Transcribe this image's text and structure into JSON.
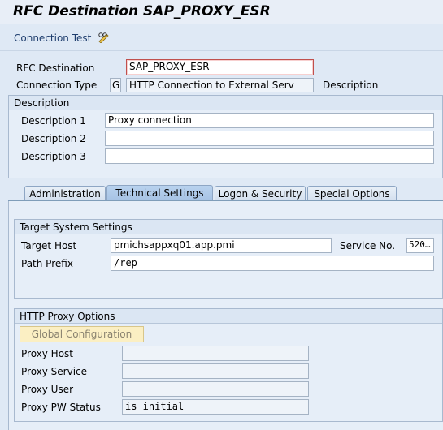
{
  "title": "RFC Destination SAP_PROXY_ESR",
  "toolbar": {
    "connection_test": "Connection Test",
    "edit_icon": "pencil-glasses-icon"
  },
  "header": {
    "rfc_destination_label": "RFC Destination",
    "rfc_destination_value": "SAP_PROXY_ESR",
    "connection_type_label": "Connection Type",
    "connection_type_code": "G",
    "connection_type_text": "HTTP Connection to External Serv",
    "description_label": "Description"
  },
  "description_group": {
    "title": "Description",
    "rows": [
      {
        "label": "Description 1",
        "value": "Proxy connection"
      },
      {
        "label": "Description 2",
        "value": ""
      },
      {
        "label": "Description 3",
        "value": ""
      }
    ]
  },
  "tabs": [
    {
      "label": "Administration"
    },
    {
      "label": "Technical Settings"
    },
    {
      "label": "Logon & Security"
    },
    {
      "label": "Special Options"
    }
  ],
  "target_system": {
    "title": "Target System Settings",
    "host_label": "Target Host",
    "host_value": "pmichsappxq01.app.pmi",
    "service_label": "Service No.",
    "service_value": "520…",
    "path_label": "Path Prefix",
    "path_value": "/rep"
  },
  "proxy": {
    "title": "HTTP Proxy Options",
    "global_config": "Global Configuration",
    "host_label": "Proxy Host",
    "host_value": "",
    "service_label": "Proxy Service",
    "service_value": "",
    "user_label": "Proxy User",
    "user_value": "",
    "pw_label": "Proxy PW Status",
    "pw_value": "is initial"
  }
}
